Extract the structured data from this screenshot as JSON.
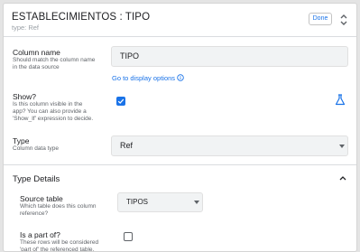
{
  "header": {
    "title": "ESTABLECIMIENTOS : TIPO",
    "subtitle": "type: Ref",
    "done_label": "Done"
  },
  "column_name": {
    "label": "Column name",
    "hint": "Should match the column name in the data source",
    "value": "TIPO",
    "display_options_link": "Go to display options"
  },
  "show": {
    "label": "Show?",
    "hint": "Is this column visible in the app? You can also provide a 'Show_If' expression to decide.",
    "checked": true
  },
  "type": {
    "label": "Type",
    "hint": "Column data type",
    "value": "Ref"
  },
  "type_details": {
    "title": "Type Details",
    "source_table": {
      "label": "Source table",
      "hint": "Which table does this column reference?",
      "value": "TIPOS"
    },
    "is_part_of": {
      "label": "Is a part of?",
      "hint": "These rows will be considered 'part of' the referenced table. They can",
      "checked": false
    }
  },
  "colors": {
    "accent": "#1a73e8",
    "field_bg": "#f1f3f4"
  }
}
